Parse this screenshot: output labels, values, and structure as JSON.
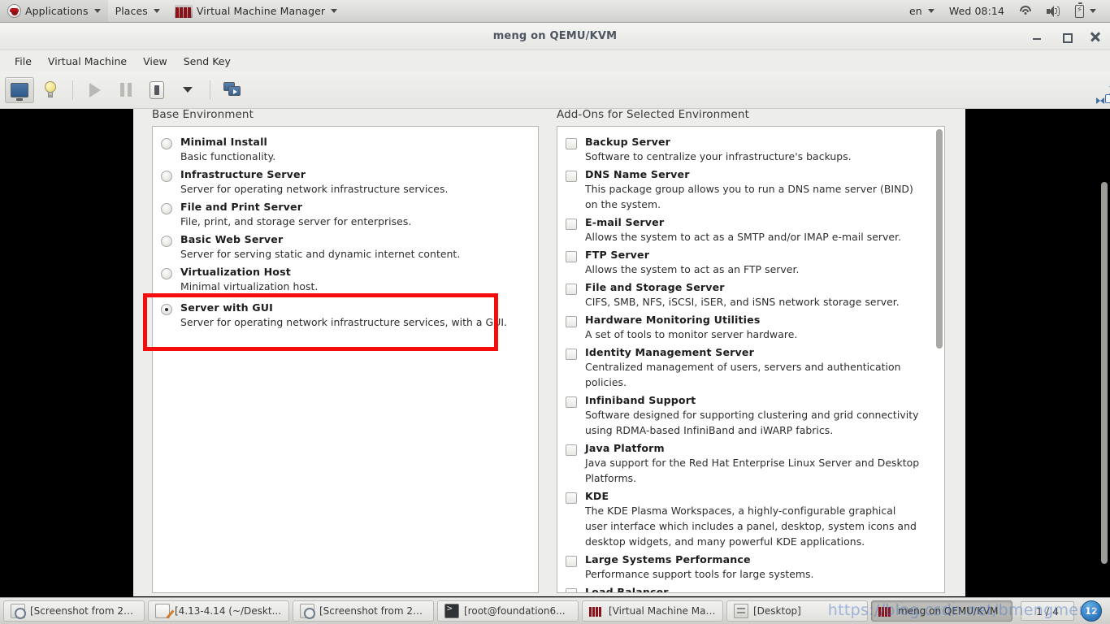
{
  "gnome_panel": {
    "menus": [
      {
        "label": "Applications",
        "icon": "redhat-logo-icon",
        "has_caret": true
      },
      {
        "label": "Places",
        "icon": null,
        "has_caret": true
      },
      {
        "label": "Virtual Machine Manager",
        "icon": "vmm-logo-icon",
        "has_caret": true
      }
    ],
    "status": {
      "keyboard_layout": "en",
      "clock": "Wed 08:14",
      "icons": [
        "wifi-icon",
        "volume-icon",
        "battery-icon"
      ]
    }
  },
  "vm_window": {
    "title": "meng on QEMU/KVM",
    "window_buttons": [
      "minimize",
      "maximize",
      "close"
    ],
    "menubar": [
      "File",
      "Virtual Machine",
      "View",
      "Send Key"
    ],
    "toolbar": [
      {
        "name": "show-console",
        "icon": "monitor-icon",
        "active": true
      },
      {
        "name": "show-details",
        "icon": "lightbulb-icon",
        "active": false
      },
      {
        "name": "run",
        "icon": "play-icon",
        "active": false,
        "disabled": true
      },
      {
        "name": "pause",
        "icon": "pause-icon",
        "active": false,
        "disabled": true
      },
      {
        "name": "shutdown",
        "icon": "power-icon",
        "active": false
      },
      {
        "name": "shutdown-options",
        "icon": "chevron-down-icon",
        "active": false
      },
      {
        "name": "snapshots",
        "icon": "snapshot-icon",
        "active": false
      },
      {
        "name": "fullscreen",
        "icon": "fullscreen-icon",
        "active": false
      }
    ]
  },
  "guest": {
    "base_environment": {
      "heading": "Base Environment",
      "options": [
        {
          "title": "Minimal Install",
          "desc": "Basic functionality.",
          "selected": false
        },
        {
          "title": "Infrastructure Server",
          "desc": "Server for operating network infrastructure services.",
          "selected": false
        },
        {
          "title": "File and Print Server",
          "desc": "File, print, and storage server for enterprises.",
          "selected": false
        },
        {
          "title": "Basic Web Server",
          "desc": "Server for serving static and dynamic internet content.",
          "selected": false
        },
        {
          "title": "Virtualization Host",
          "desc": "Minimal virtualization host.",
          "selected": false
        },
        {
          "title": "Server with GUI",
          "desc": "Server for operating network infrastructure services, with a GUI.",
          "selected": true
        }
      ]
    },
    "addons": {
      "heading": "Add-Ons for Selected Environment",
      "options": [
        {
          "title": "Backup Server",
          "desc": "Software to centralize your infrastructure's backups.",
          "checked": false
        },
        {
          "title": "DNS Name Server",
          "desc": "This package group allows you to run a DNS name server (BIND) on the system.",
          "checked": false
        },
        {
          "title": "E-mail Server",
          "desc": "Allows the system to act as a SMTP and/or IMAP e-mail server.",
          "checked": false
        },
        {
          "title": "FTP Server",
          "desc": "Allows the system to act as an FTP server.",
          "checked": false
        },
        {
          "title": "File and Storage Server",
          "desc": "CIFS, SMB, NFS, iSCSI, iSER, and iSNS network storage server.",
          "checked": false
        },
        {
          "title": "Hardware Monitoring Utilities",
          "desc": "A set of tools to monitor server hardware.",
          "checked": false
        },
        {
          "title": "Identity Management Server",
          "desc": "Centralized management of users, servers and authentication policies.",
          "checked": false
        },
        {
          "title": "Infiniband Support",
          "desc": "Software designed for supporting clustering and grid connectivity using RDMA-based InfiniBand and iWARP fabrics.",
          "checked": false
        },
        {
          "title": "Java Platform",
          "desc": "Java support for the Red Hat Enterprise Linux Server and Desktop Platforms.",
          "checked": false
        },
        {
          "title": "KDE",
          "desc": "The KDE Plasma Workspaces, a highly-configurable graphical user interface which includes a panel, desktop, system icons and desktop widgets, and many powerful KDE applications.",
          "checked": false
        },
        {
          "title": "Large Systems Performance",
          "desc": "Performance support tools for large systems.",
          "checked": false
        },
        {
          "title": "Load Balancer",
          "desc": "",
          "checked": false
        }
      ]
    }
  },
  "annotation": {
    "color": "#f40d0d",
    "target": "Server with GUI"
  },
  "taskbar": {
    "items": [
      {
        "label": "[Screenshot from 20...",
        "icon": "screenshot-icon",
        "active": false
      },
      {
        "label": "[4.13-4.14 (~/Deskt...",
        "icon": "text-editor-icon",
        "active": false
      },
      {
        "label": "[Screenshot from 20...",
        "icon": "screenshot-icon",
        "active": false
      },
      {
        "label": "[root@foundation6...",
        "icon": "terminal-icon",
        "active": false
      },
      {
        "label": "[Virtual Machine Man...",
        "icon": "vmm-logo-icon",
        "active": false
      },
      {
        "label": "[Desktop]",
        "icon": "file-manager-icon",
        "active": false
      },
      {
        "label": "meng on QEMU/KVM",
        "icon": "vmm-logo-icon",
        "active": true
      }
    ],
    "workspace_indicator": "1 / 4",
    "notification_badge": "12"
  },
  "watermark": "https://blog.csdn.net/bmengmeng"
}
